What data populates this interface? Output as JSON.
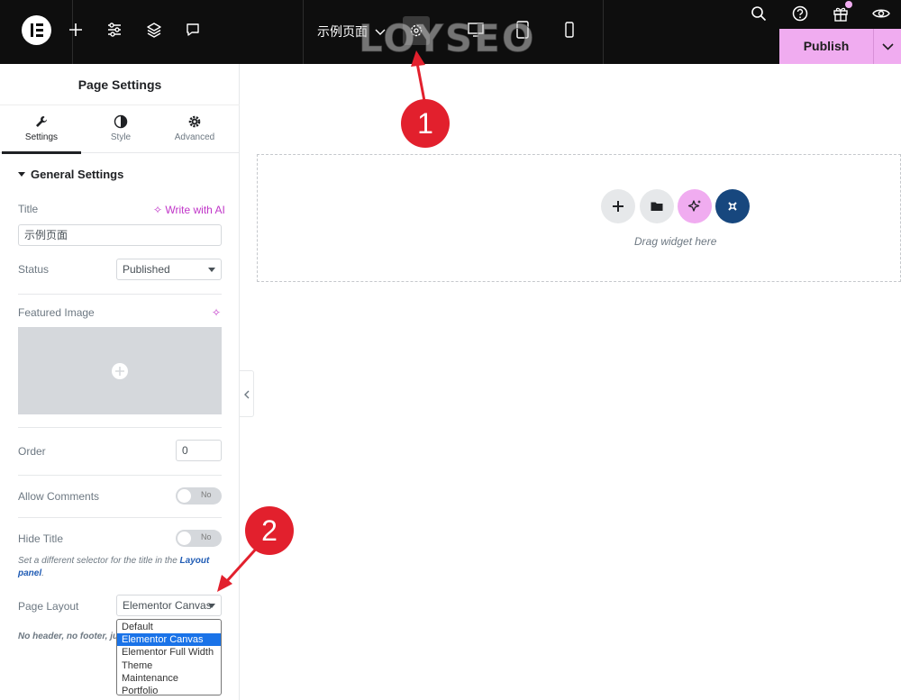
{
  "topbar": {
    "page_name": "示例页面",
    "publish_label": "Publish",
    "watermark": "LOYSEO",
    "icons": [
      "elementor-logo-icon",
      "add-icon",
      "settings-sliders-icon",
      "layers-icon",
      "comments-icon",
      "chevron-down-icon",
      "gear-icon",
      "desktop-icon",
      "tablet-icon",
      "mobile-icon",
      "search-icon",
      "help-icon",
      "gift-icon",
      "preview-eye-icon"
    ]
  },
  "panel": {
    "title": "Page Settings",
    "tabs": [
      {
        "label": "Settings",
        "icon": "wrench-icon"
      },
      {
        "label": "Style",
        "icon": "half-circle-icon"
      },
      {
        "label": "Advanced",
        "icon": "gear-icon"
      }
    ],
    "section_title": "General Settings",
    "title_label": "Title",
    "write_with_ai": "Write with AI",
    "title_value": "示例页面",
    "status_label": "Status",
    "status_value": "Published",
    "featured_image_label": "Featured Image",
    "order_label": "Order",
    "order_value": "0",
    "allow_comments_label": "Allow Comments",
    "allow_comments_value": "No",
    "hide_title_label": "Hide Title",
    "hide_title_value": "No",
    "hint_text": "Set a different selector for the title in the",
    "hint_link": "Layout panel",
    "hint_end": ".",
    "page_layout_label": "Page Layout",
    "page_layout_value": "Elementor Canvas",
    "page_layout_note": "No header, no footer, ju",
    "page_layout_options": [
      "Default",
      "Elementor Canvas",
      "Elementor Full Width",
      "Theme",
      "Maintenance",
      "Portfolio"
    ],
    "page_layout_selected_index": 1
  },
  "canvas": {
    "drag_text": "Drag widget here"
  },
  "annotations": {
    "badge_1": "1",
    "badge_2": "2"
  },
  "colors": {
    "topbar_bg": "#0e0e0e",
    "publish_bg": "#f0acf0",
    "ai_accent": "#c036c8",
    "badge_red": "#e2202d",
    "elementor_blue": "#17477e"
  }
}
